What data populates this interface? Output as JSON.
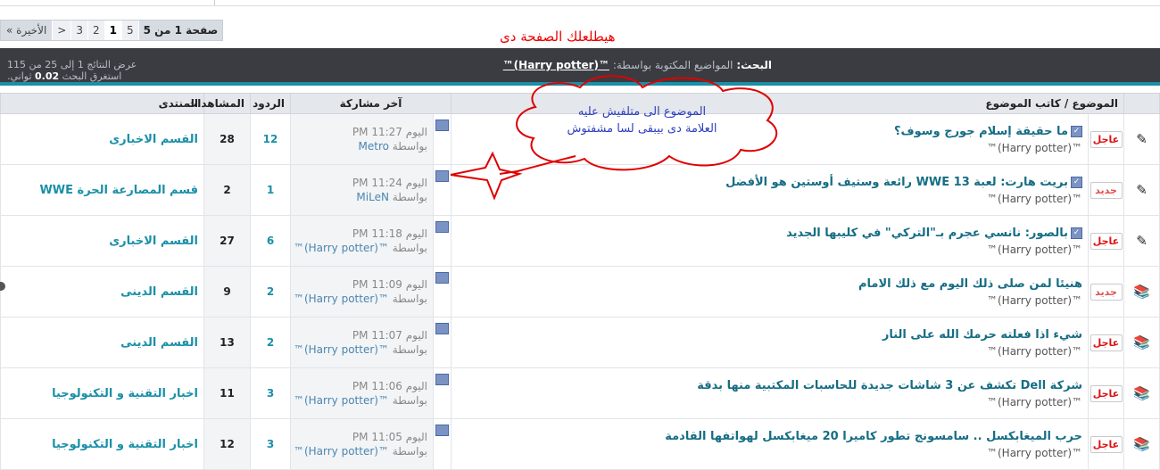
{
  "pager": {
    "first": "« الأخيرة",
    "next": ">",
    "pages": [
      "3",
      "2",
      "1"
    ],
    "current": "5",
    "label": "صفحة 1 من 5"
  },
  "annotation_top": "هيطلعلك الصفحة دى",
  "search_bar": {
    "label": "البحث:",
    "criteria": "المواضيع المكتوبة بواسطة:",
    "user": "™(Harry potter)™",
    "results": "عرض النتائج 1 إلى 25 من 115",
    "time_label": "استغرق البحث",
    "time_value": "0.02",
    "time_unit": "ثواني."
  },
  "headers": {
    "topic": "الموضوع / كاتب الموضوع",
    "last_post": "آخر مشاركة",
    "replies": "الردود",
    "views": "المشاهدات",
    "forum": "المنتدى"
  },
  "cloud": {
    "line1": "الموضوع الى متلفيش عليه",
    "line2": "العلامة دى بيبقى لسا مشفتوش"
  },
  "rows": [
    {
      "icon": "✎",
      "badge": "عاجل",
      "badge_type": "red",
      "checked": true,
      "title": "ما حقيقة إسلام جورج وسوف؟",
      "author": "™(Harry potter)™",
      "time": "اليوم 11:27 PM",
      "by_label": "بواسطة",
      "by_user": "Metro",
      "replies": "12",
      "views": "28",
      "forum": "القسم الاخبارى"
    },
    {
      "icon": "✎",
      "badge": "جديد",
      "badge_type": "new",
      "checked": true,
      "title": "بريت هارت: لعبة WWE 13 رائعة وستيف أوستين هو الأفضل",
      "author": "™(Harry potter)™",
      "time": "اليوم 11:24 PM",
      "by_label": "بواسطة",
      "by_user": "MiLeN",
      "replies": "1",
      "views": "2",
      "forum": "قسم المصارعة الحرة WWE"
    },
    {
      "icon": "✎",
      "badge": "عاجل",
      "badge_type": "red",
      "checked": true,
      "title": "بالصور: نانسي عجرم بـ\"التركي\" في كليبها الجديد",
      "author": "™(Harry potter)™",
      "time": "اليوم 11:18 PM",
      "by_label": "بواسطة",
      "by_user": "™(Harry potter)™",
      "replies": "6",
      "views": "27",
      "forum": "القسم الاخبارى"
    },
    {
      "icon": "📚",
      "badge": "جديد",
      "badge_type": "new",
      "checked": false,
      "title": "هنيئا لمن صلى ذلك اليوم مع ذلك الامام",
      "author": "™(Harry potter)™",
      "time": "اليوم 11:09 PM",
      "by_label": "بواسطة",
      "by_user": "™(Harry potter)™",
      "replies": "2",
      "views": "9",
      "forum": "القسم الدينى"
    },
    {
      "icon": "📚",
      "badge": "عاجل",
      "badge_type": "red",
      "checked": false,
      "title": "شيء اذا فعلته حرمك الله على النار",
      "author": "™(Harry potter)™",
      "time": "اليوم 11:07 PM",
      "by_label": "بواسطة",
      "by_user": "™(Harry potter)™",
      "replies": "2",
      "views": "13",
      "forum": "القسم الدينى"
    },
    {
      "icon": "📚",
      "badge": "عاجل",
      "badge_type": "red",
      "checked": false,
      "title": "شركة Dell تكشف عن 3 شاشات جديدة للحاسبات المكتبية منها بدقة",
      "author": "™(Harry potter)™",
      "time": "اليوم 11:06 PM",
      "by_label": "بواسطة",
      "by_user": "™(Harry potter)™",
      "replies": "3",
      "views": "11",
      "forum": "اخبار التقنية و التكنولوجيا"
    },
    {
      "icon": "📚",
      "badge": "عاجل",
      "badge_type": "red",
      "checked": false,
      "title": "حرب الميغابكسل .. سامسونج تطور كاميرا 20 ميغابكسل لهواتفها القادمة",
      "author": "™(Harry potter)™",
      "time": "اليوم 11:05 PM",
      "by_label": "بواسطة",
      "by_user": "™(Harry potter)™",
      "replies": "3",
      "views": "12",
      "forum": "اخبار التقنية و التكنولوجيا"
    }
  ],
  "colors": {
    "accent": "#1a8fa8",
    "annotation": "#e00000",
    "bar": "#3a3c42"
  }
}
